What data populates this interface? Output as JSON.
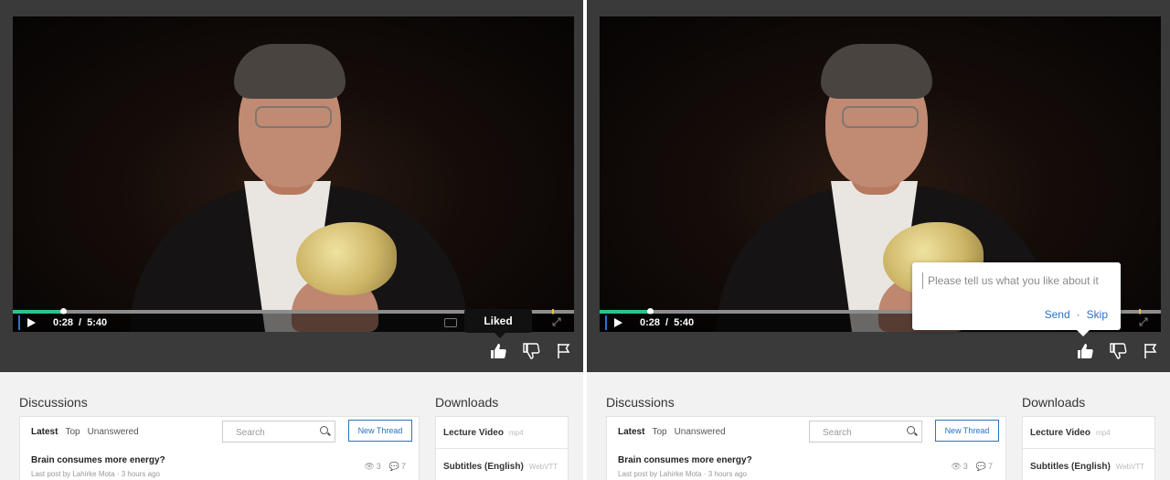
{
  "panels": [
    {
      "time": {
        "current": "0:28",
        "separator": "/",
        "duration": "5:40"
      },
      "progress_fraction": 0.09,
      "tooltip": "Liked",
      "feedback": null
    },
    {
      "time": {
        "current": "0:28",
        "separator": "/",
        "duration": "5:40"
      },
      "progress_fraction": 0.09,
      "tooltip": null,
      "feedback": {
        "placeholder": "Please tell us what you like about it",
        "send": "Send",
        "separator": "·",
        "skip": "Skip"
      }
    }
  ],
  "discussions": {
    "heading": "Discussions",
    "tabs": [
      "Latest",
      "Top",
      "Unanswered"
    ],
    "active_tab": "Latest",
    "search_placeholder": "Search",
    "new_thread_label": "New Thread",
    "thread": {
      "title": "Brain consumes more energy?",
      "meta": "Last post by Lahirke Mota · 3 hours ago",
      "views": "3",
      "comments": "7"
    }
  },
  "downloads": {
    "heading": "Downloads",
    "items": [
      {
        "label": "Lecture Video",
        "format": "mp4"
      },
      {
        "label": "Subtitles (English)",
        "format": "WebVTT"
      }
    ]
  },
  "icons": [
    "play-icon",
    "captions-icon",
    "settings-icon",
    "fullscreen-icon",
    "thumbs-up-icon",
    "thumbs-down-icon",
    "flag-icon",
    "search-icon",
    "views-icon",
    "comments-icon"
  ],
  "colors": {
    "accent_blue": "#2a73c5",
    "progress_green": "#33c08f",
    "player_bg": "#3a3a3a",
    "page_bg": "#f2f2f2"
  }
}
